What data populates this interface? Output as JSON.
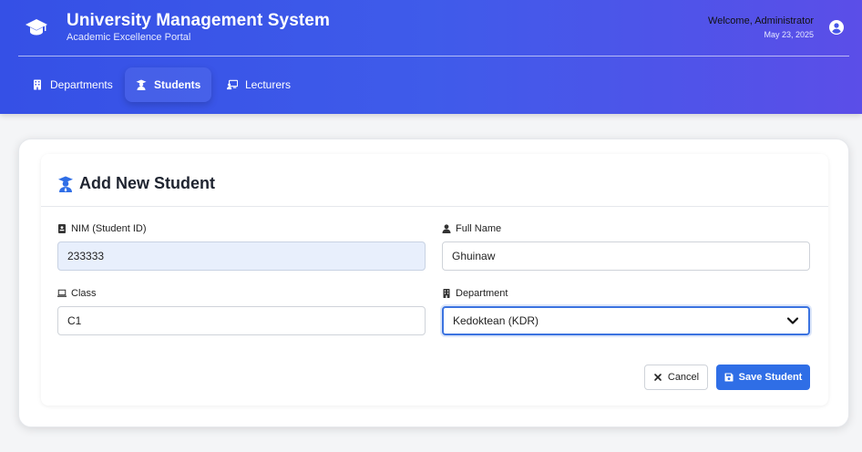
{
  "header": {
    "title": "University Management System",
    "subtitle": "Academic Excellence Portal",
    "welcome": "Welcome, Administrator",
    "date": "May 23, 2025",
    "tabs": [
      {
        "label": "Departments",
        "icon": "building-icon",
        "active": false
      },
      {
        "label": "Students",
        "icon": "graduate-icon",
        "active": true
      },
      {
        "label": "Lecturers",
        "icon": "chalkboard-teacher-icon",
        "active": false
      }
    ]
  },
  "form": {
    "title": "Add New Student",
    "fields": {
      "nim": {
        "label": "NIM (Student ID)",
        "value": "233333"
      },
      "full_name": {
        "label": "Full Name",
        "value": "Ghuinaw"
      },
      "class": {
        "label": "Class",
        "value": "C1"
      },
      "department": {
        "label": "Department",
        "value": "Kedoktean (KDR)"
      }
    },
    "cancel_label": "Cancel",
    "save_label": "Save Student"
  },
  "colors": {
    "header_gradient_start": "#3550e6",
    "header_gradient_end": "#5b4ee8",
    "primary_button": "#2f6ee6",
    "readonly_field": "#e8effc"
  }
}
